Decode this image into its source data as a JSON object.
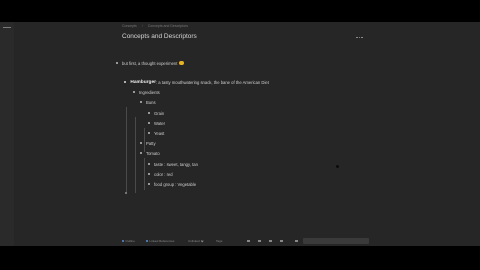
{
  "breadcrumb": [
    "Concepts",
    "Concepts and Descriptors"
  ],
  "page": {
    "title": "Concepts and Descriptors"
  },
  "outline": [
    {
      "text": "but first, a thought experiment",
      "emoji": "thinking-face"
    },
    {
      "label": "Hamburger",
      "text": ": a tasty mouthwatering snack, the bane of the American Diet"
    },
    {
      "text": "Ingredients"
    },
    {
      "text": "Buns"
    },
    {
      "text": "Grain"
    },
    {
      "text": "Water"
    },
    {
      "text": "Yeast"
    },
    {
      "text": "Patty"
    },
    {
      "text": "Tomato"
    },
    {
      "text": "taste : sweet, tangy, tan"
    },
    {
      "text": "color : red"
    },
    {
      "text": "food group : Vegetable"
    }
  ],
  "status_bar": {
    "items": [
      "Outline",
      "Linked References",
      "Unlinked",
      "Tags"
    ]
  },
  "colors": {
    "background": "#262626",
    "text": "#cfcfcf",
    "title": "#d6d6d6",
    "accent": "#5a8fd1",
    "emoji": "#e6b422"
  }
}
